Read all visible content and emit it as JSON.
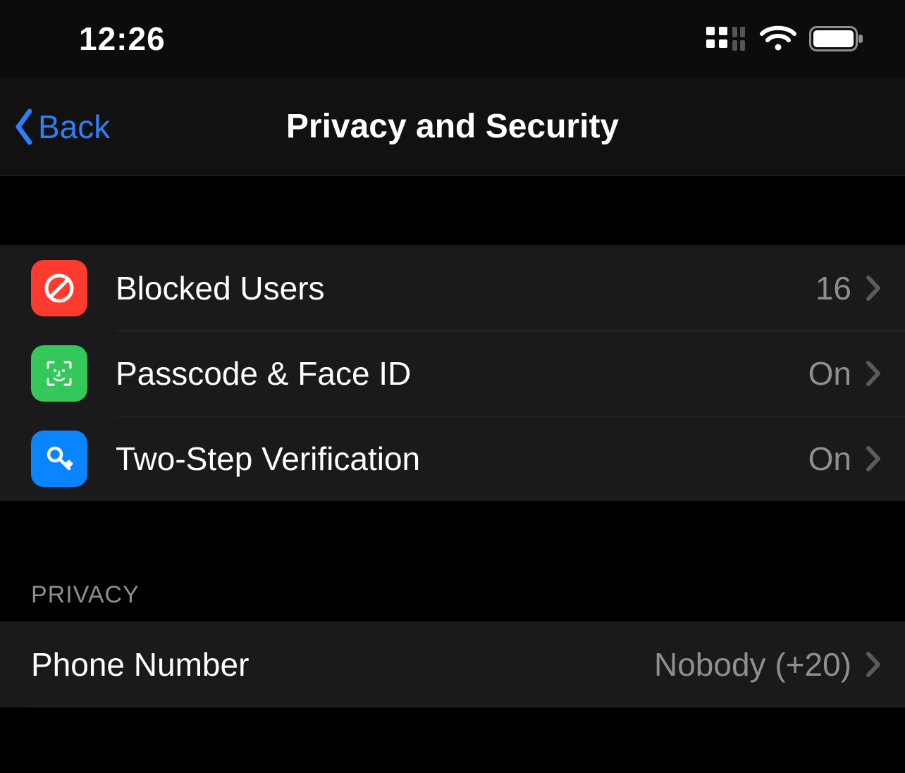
{
  "statusbar": {
    "time": "12:26"
  },
  "nav": {
    "back": "Back",
    "title": "Privacy and Security"
  },
  "security_rows": [
    {
      "icon": "blocked",
      "label": "Blocked Users",
      "value": "16"
    },
    {
      "icon": "faceid",
      "label": "Passcode & Face ID",
      "value": "On"
    },
    {
      "icon": "twostep",
      "label": "Two-Step Verification",
      "value": "On"
    }
  ],
  "privacy": {
    "header": "PRIVACY",
    "rows": [
      {
        "label": "Phone Number",
        "value": "Nobody (+20)"
      }
    ]
  },
  "icons": {
    "blocked": "no-entry-icon",
    "faceid": "faceid-icon",
    "twostep": "key-icon"
  },
  "colors": {
    "accent": "#2f7ff6",
    "blocked": "#ff3b30",
    "faceid": "#34c759",
    "twostep": "#0a84ff",
    "muted": "#8e8e93"
  }
}
